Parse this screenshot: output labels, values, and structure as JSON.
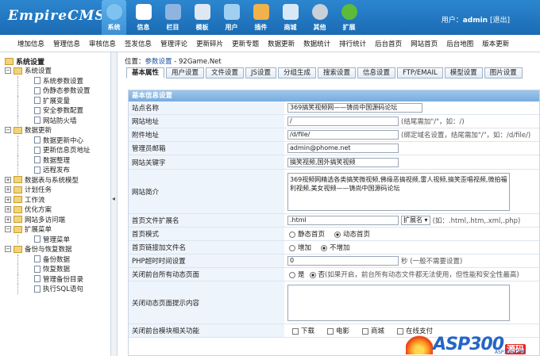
{
  "header": {
    "logo_main": "EmpireCMS",
    "nav": [
      {
        "label": "系统",
        "icon": "globe-icon",
        "color": "#7ec3f0",
        "active": true
      },
      {
        "label": "信息",
        "icon": "document-icon",
        "color": "#ffffff"
      },
      {
        "label": "栏目",
        "icon": "folder-icon",
        "color": "#8fb4e0"
      },
      {
        "label": "模板",
        "icon": "template-icon",
        "color": "#dfe7f2"
      },
      {
        "label": "用户",
        "icon": "user-icon",
        "color": "#9fd0f2"
      },
      {
        "label": "插件",
        "icon": "tools-icon",
        "color": "#f0b24a"
      },
      {
        "label": "商城",
        "icon": "shop-icon",
        "color": "#d7e9f7"
      },
      {
        "label": "其他",
        "icon": "gear-icon",
        "color": "#c8d0da"
      },
      {
        "label": "扩展",
        "icon": "plus-icon",
        "color": "#5cbc3a"
      }
    ],
    "user_label": "用户：",
    "user_name": "admin",
    "logout": "[退出]"
  },
  "menubar": [
    "增加信息",
    "管理信息",
    "审核信息",
    "签发信息",
    "管理评论",
    "更新碎片",
    "更新专题",
    "数据更新",
    "数据统计",
    "排行统计",
    "后台首页",
    "网站首页",
    "后台地图",
    "版本更新"
  ],
  "sidebar": {
    "root": "系统设置",
    "groups": [
      {
        "label": "系统设置",
        "open": true,
        "items": [
          "系统参数设置",
          "伪静态参数设置",
          "扩展变量",
          "安全参数配置",
          "网站防火墙"
        ]
      },
      {
        "label": "数据更新",
        "open": true,
        "items": [
          "数据更新中心",
          "更新信息页地址",
          "数据整理",
          "远程发布"
        ]
      },
      {
        "label": "数据表与系统模型",
        "open": false,
        "items": []
      },
      {
        "label": "计划任务",
        "open": false,
        "items": []
      },
      {
        "label": "工作流",
        "open": false,
        "items": []
      },
      {
        "label": "优化方案",
        "open": false,
        "items": []
      },
      {
        "label": "网站多访问端",
        "open": false,
        "items": []
      },
      {
        "label": "扩展菜单",
        "open": true,
        "items": [
          "管理菜单"
        ]
      },
      {
        "label": "备份与恢复数据",
        "open": true,
        "items": [
          "备份数据",
          "恢复数据",
          "管理备份目录",
          "执行SQL语句"
        ]
      }
    ]
  },
  "main": {
    "crumb_prefix": "位置：",
    "crumb_link": "参数设置",
    "crumb_suffix": " - 92Game.Net",
    "tabs": [
      "基本属性",
      "用户设置",
      "文件设置",
      "JS设置",
      "分组生成",
      "搜索设置",
      "信息设置",
      "FTP/EMAIL",
      "模型设置",
      "图片设置"
    ],
    "section_title": "基本信息设置",
    "fields": {
      "site_name_label": "站点名称",
      "site_name_value": "369搞笑视频网——铸尚中国源码论坛",
      "site_url_label": "网站地址",
      "site_url_value": "/",
      "site_url_hint": "(结尾需加\"/\"，如：/)",
      "attach_url_label": "附件地址",
      "attach_url_value": "/d/file/",
      "attach_url_hint": "(绑定域名设置，结尾需加\"/\"，如：/d/file/)",
      "email_label": "管理员邮箱",
      "email_value": "admin@phome.net",
      "keywords_label": "网站关键字",
      "keywords_value": "搞笑视频,国外搞笑视频",
      "intro_label": "网站简介",
      "intro_value": "369视频网精选各类搞笑微视频,佛缘恶搞视频,雷人视频,搞笑歪唱视频,微拍福利视频,美女视频——铸尚中国源码论坛",
      "index_ext_label": "首页文件扩展名",
      "index_ext_value": ".html",
      "index_ext_select": "扩展名",
      "index_ext_hint": "(如：.html,.htm,.xml,.php)",
      "index_mode_label": "首页模式",
      "index_mode_opt1": "静态首页",
      "index_mode_opt2": "动态首页",
      "index_link_label": "首页链接加文件名",
      "index_link_opt1": "增加",
      "index_link_opt2": "不增加",
      "timeout_label": "PHP超时时间设置",
      "timeout_value": "0",
      "timeout_hint": "秒 (一般不需要设置)",
      "close_dynamic_label": "关闭前台所有动态页面",
      "close_dynamic_opt1": "是",
      "close_dynamic_opt2": "否",
      "close_dynamic_hint": "(如果开启，前台所有动态文件都无法使用，但性能和安全性最高)",
      "close_tip_label": "关闭动态页面提示内容",
      "close_tip_value": "",
      "close_module_label": "关闭前台模块相关功能",
      "module_opts": [
        "下载",
        "电影",
        "商城",
        "在线支付"
      ]
    }
  },
  "watermark": {
    "text": "ASP300",
    "sub": "源码",
    "domain": "ASP300.COM"
  }
}
